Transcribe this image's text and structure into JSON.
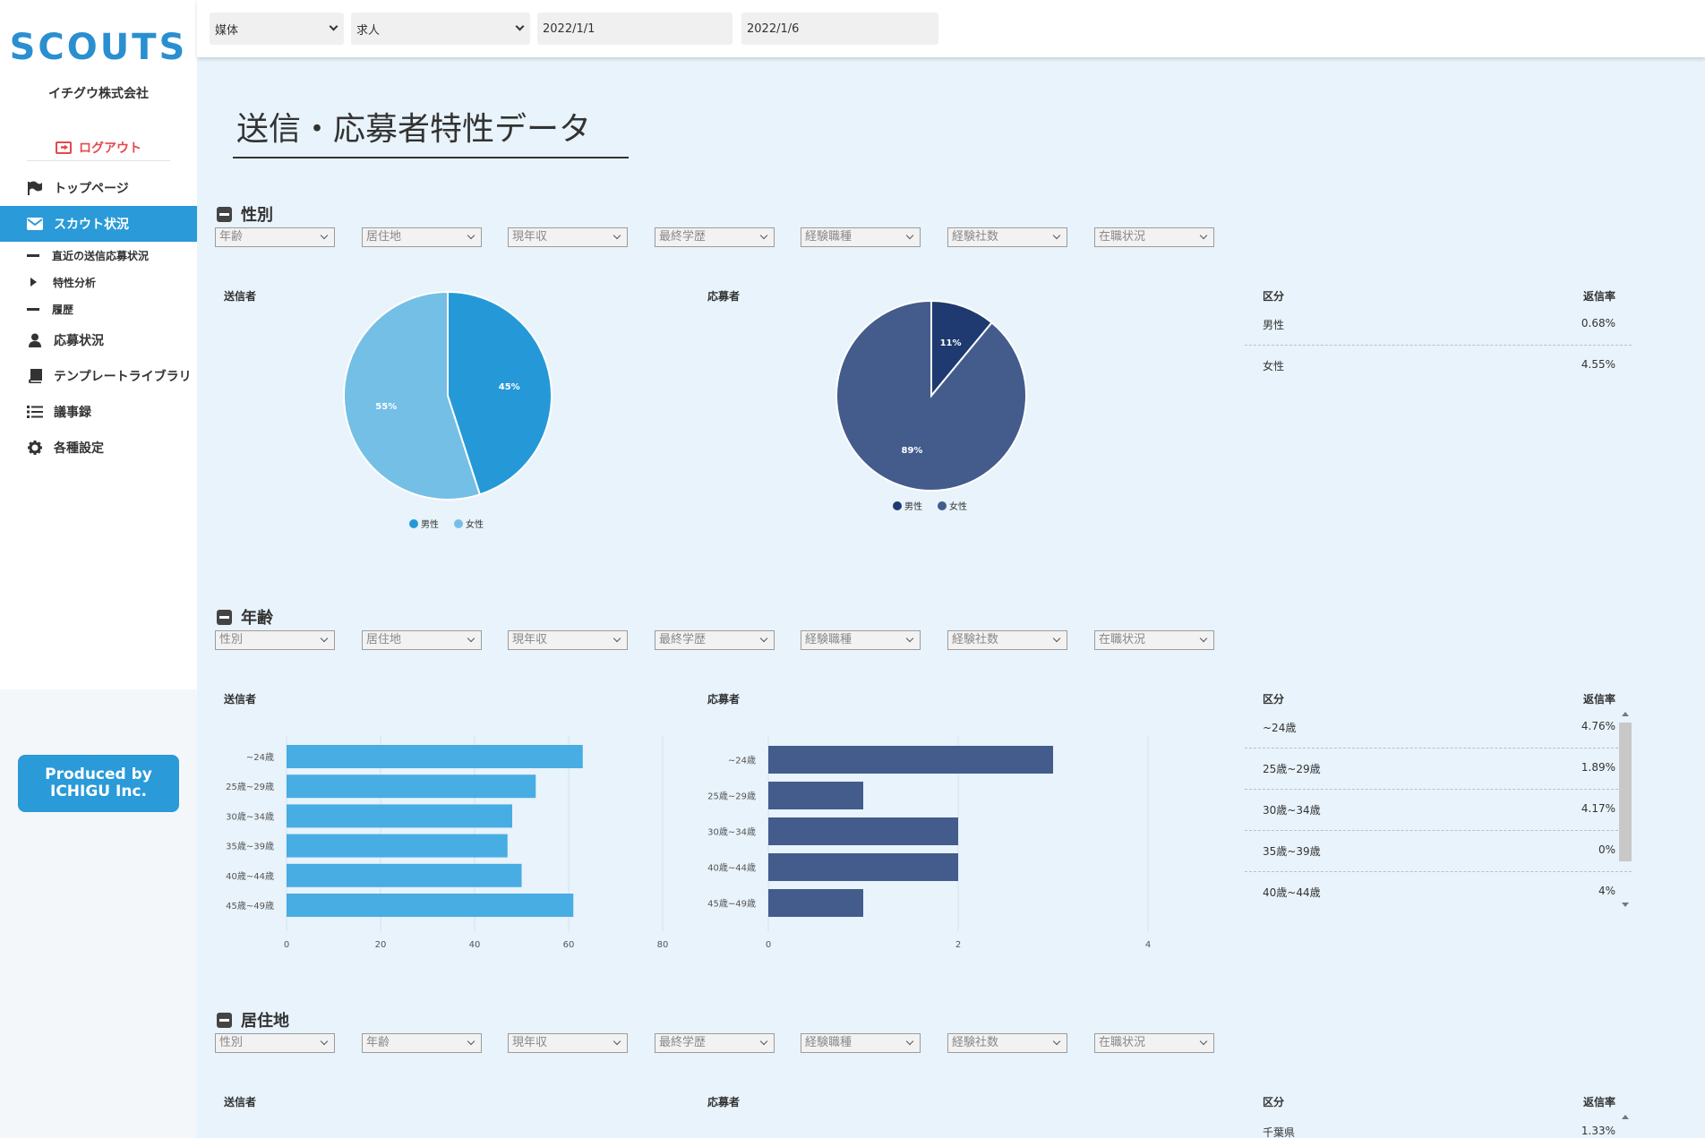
{
  "sidebar": {
    "logo": "SCOUTS",
    "company": "イチグウ株式会社",
    "logout": "ログアウト",
    "items": [
      {
        "label": "トップページ",
        "icon": "flag-icon"
      },
      {
        "label": "スカウト状況",
        "icon": "envelope-icon",
        "active": true
      },
      {
        "label": "直近の送信応募状況",
        "icon": "dash-icon",
        "sub": true
      },
      {
        "label": "特性分析",
        "icon": "caret-right-icon",
        "sub": true
      },
      {
        "label": "履歴",
        "icon": "dash-icon",
        "sub": true
      },
      {
        "label": "応募状況",
        "icon": "user-icon"
      },
      {
        "label": "テンプレートライブラリ",
        "icon": "book-icon"
      },
      {
        "label": "議事録",
        "icon": "list-icon"
      },
      {
        "label": "各種設定",
        "icon": "gear-icon"
      }
    ],
    "produced_by_line1": "Produced by",
    "produced_by_line2": "ICHIGU Inc."
  },
  "topbar": {
    "media": "媒体",
    "job": "求人",
    "date_from": "2022/1/1",
    "date_to": "2022/1/6"
  },
  "page_title": "送信・応募者特性データ",
  "labels": {
    "sender": "送信者",
    "applicant": "応募者",
    "category": "区分",
    "reply_rate": "返信率"
  },
  "sections": {
    "gender": {
      "title": "性別",
      "filters": [
        "年齢",
        "居住地",
        "現年収",
        "最終学歴",
        "経験職種",
        "経験社数",
        "在職状況"
      ],
      "table": [
        {
          "k": "男性",
          "v": "0.68%"
        },
        {
          "k": "女性",
          "v": "4.55%"
        }
      ]
    },
    "age": {
      "title": "年齢",
      "filters": [
        "性別",
        "居住地",
        "現年収",
        "最終学歴",
        "経験職種",
        "経験社数",
        "在職状況"
      ],
      "table": [
        {
          "k": "~24歳",
          "v": "4.76%"
        },
        {
          "k": "25歳~29歳",
          "v": "1.89%"
        },
        {
          "k": "30歳~34歳",
          "v": "4.17%"
        },
        {
          "k": "35歳~39歳",
          "v": "0%"
        },
        {
          "k": "40歳~44歳",
          "v": "4%"
        }
      ]
    },
    "residence": {
      "title": "居住地",
      "filters": [
        "性別",
        "年齢",
        "現年収",
        "最終学歴",
        "経験職種",
        "経験社数",
        "在職状況"
      ],
      "table": [
        {
          "k": "千葉県",
          "v": "1.33%"
        }
      ]
    }
  },
  "colors": {
    "accent": "#2a9ad8",
    "male_sender": "#2599d8",
    "female_sender": "#74bfe6",
    "male_applicant": "#1e3a70",
    "female_applicant": "#435c8c",
    "logout": "#e5484d"
  },
  "chart_data": [
    {
      "type": "pie",
      "title": "送信者",
      "categories": [
        "男性",
        "女性"
      ],
      "values": [
        45,
        55
      ],
      "data_labels": [
        "45%",
        "55%"
      ],
      "legend": "bottom"
    },
    {
      "type": "pie",
      "title": "応募者",
      "categories": [
        "男性",
        "女性"
      ],
      "values": [
        11,
        89
      ],
      "data_labels": [
        "11%",
        "89%"
      ],
      "legend": "bottom"
    },
    {
      "type": "bar",
      "orientation": "horizontal",
      "title": "送信者",
      "categories": [
        "~24歳",
        "25歳~29歳",
        "30歳~34歳",
        "35歳~39歳",
        "40歳~44歳",
        "45歳~49歳"
      ],
      "values": [
        63,
        53,
        48,
        47,
        50,
        61
      ],
      "xlim": [
        0,
        80
      ],
      "xticks": [
        0,
        20,
        40,
        60,
        80
      ],
      "grid": true
    },
    {
      "type": "bar",
      "orientation": "horizontal",
      "title": "応募者",
      "categories": [
        "~24歳",
        "25歳~29歳",
        "30歳~34歳",
        "40歳~44歳",
        "45歳~49歳"
      ],
      "values": [
        3,
        1,
        2,
        2,
        1
      ],
      "xlim": [
        0,
        4
      ],
      "xticks": [
        0,
        2,
        4
      ],
      "grid": true
    }
  ]
}
